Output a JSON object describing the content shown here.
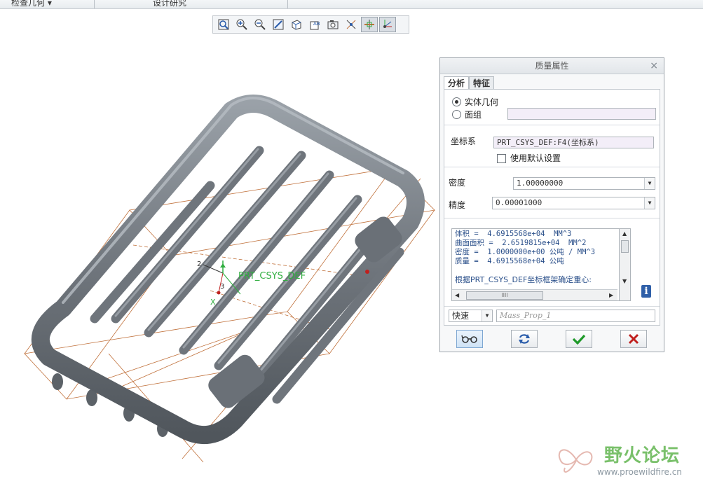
{
  "top_tabs": [
    "检查几何 ▾",
    "设计研究"
  ],
  "model": {
    "csys_label": "PRT_CSYS_DEF",
    "axis_x": "X",
    "axis_num_2": "2",
    "axis_num_3": "3"
  },
  "dialog": {
    "title": "质量属性",
    "close": "×",
    "tabs": [
      "分析",
      "特征"
    ],
    "radio_solid": "实体几何",
    "radio_quilt": "面组",
    "csys_label": "坐标系",
    "csys_value": "PRT_CSYS_DEF:F4(坐标系)",
    "use_default": "使用默认设置",
    "density_label": "密度",
    "density_value": "1.00000000",
    "accuracy_label": "精度",
    "accuracy_value": "0.00001000",
    "results": [
      "体积 =  4.6915568e+04  MM^3",
      "曲面面积 =  2.6519815e+04  MM^2",
      "密度 =  1.0000000e+00 公吨 / MM^3",
      "质量 =  4.6915568e+04 公吨"
    ],
    "results_note": "根据PRT_CSYS_DEF坐标框架确定重心:",
    "scroll_thumb": "IIII",
    "mode_value": "快速",
    "name_placeholder": "Mass_Prop_1",
    "selected_tab": "分析"
  },
  "watermark": {
    "text": "野火论坛",
    "url": "www.proewildfire.cn"
  },
  "colors": {
    "model_gray": "#6f757c",
    "datum_orange": "#c0703a",
    "csys_green": "#2fae3f",
    "results_blue": "#2a4f8a",
    "ok_green": "#1f9a2a",
    "cancel_red": "#c0201e"
  }
}
